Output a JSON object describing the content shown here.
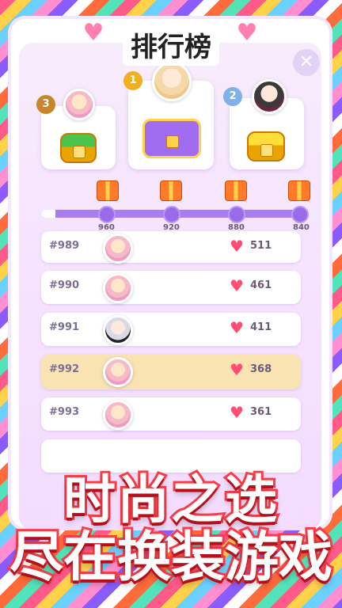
{
  "header": {
    "title": "排行榜"
  },
  "podium": [
    {
      "rank": "3",
      "chest": "gold-green"
    },
    {
      "rank": "1",
      "chest": "purple"
    },
    {
      "rank": "2",
      "chest": "gold"
    }
  ],
  "progress": {
    "ticks": [
      "960",
      "920",
      "880",
      "840"
    ]
  },
  "rows": [
    {
      "rank": "#989",
      "score": "511",
      "me": false
    },
    {
      "rank": "#990",
      "score": "461",
      "me": false
    },
    {
      "rank": "#991",
      "score": "411",
      "me": false
    },
    {
      "rank": "#992",
      "score": "368",
      "me": true
    },
    {
      "rank": "#993",
      "score": "361",
      "me": false
    }
  ],
  "slogan": {
    "line1": "时尚之选",
    "line2": "尽在换装游戏"
  },
  "colors": {
    "accent": "#a77df0",
    "heart": "#ff4d73",
    "highlight": "#f9e3b3"
  }
}
